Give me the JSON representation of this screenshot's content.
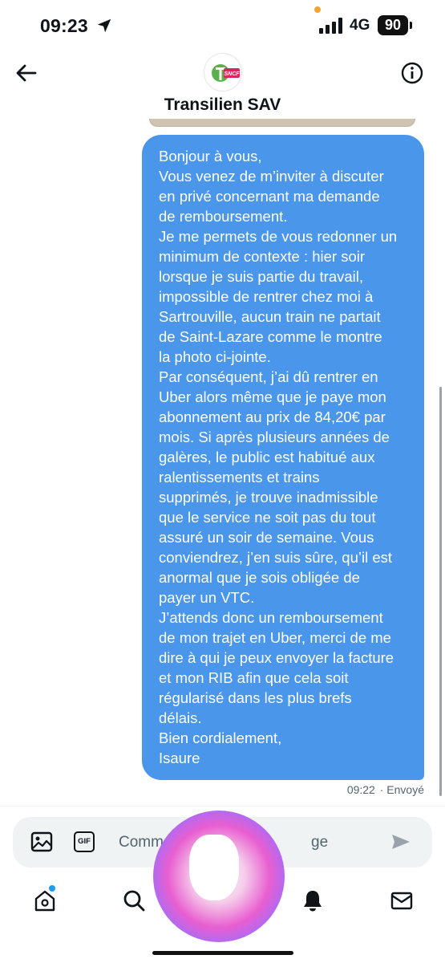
{
  "status_bar": {
    "time": "09:23",
    "network": "4G",
    "battery": "90"
  },
  "header": {
    "title": "Transilien SAV",
    "avatar_brand": "SNCF"
  },
  "message": {
    "lines": [
      "Bonjour à vous,",
      "Vous venez de m’inviter à discuter",
      "en privé concernant ma demande",
      "de remboursement.",
      "Je me permets de vous redonner un",
      "minimum de contexte : hier soir",
      "lorsque je suis partie du travail,",
      "impossible de rentrer chez moi à",
      "Sartrouville, aucun train ne partait",
      "de Saint-Lazare comme le montre",
      "la photo ci-jointe.",
      "Par conséquent, j’ai dû rentrer en",
      "Uber alors même que je paye mon",
      "abonnement au prix de 84,20€ par",
      "mois. Si après plusieurs années de",
      "galères, le public est habitué aux",
      "ralentissements et trains",
      "supprimés, je trouve inadmissible",
      "que le service ne soit pas du tout",
      "assuré un soir de semaine. Vous",
      "conviendrez, j’en suis sûre, qu’il est",
      "anormal que je sois obligée de",
      "payer un VTC.",
      "J’attends donc un remboursement",
      "de mon trajet en Uber, merci de me",
      "dire à qui je peux envoyer la facture",
      "et mon RIB afin que cela soit",
      "régularisé dans les plus brefs",
      "délais.",
      "Bien cordialement,",
      "Isaure"
    ],
    "time": "09:22",
    "status": "· Envoyé",
    "color": "#4a96ea"
  },
  "composer": {
    "placeholder_start": "Comme",
    "placeholder_end": "ge",
    "gif_label": "GIF"
  },
  "tabbar": {
    "items": [
      "home-icon",
      "search-icon",
      "bell-icon",
      "mail-icon"
    ],
    "accent": "#1d9bf0"
  }
}
